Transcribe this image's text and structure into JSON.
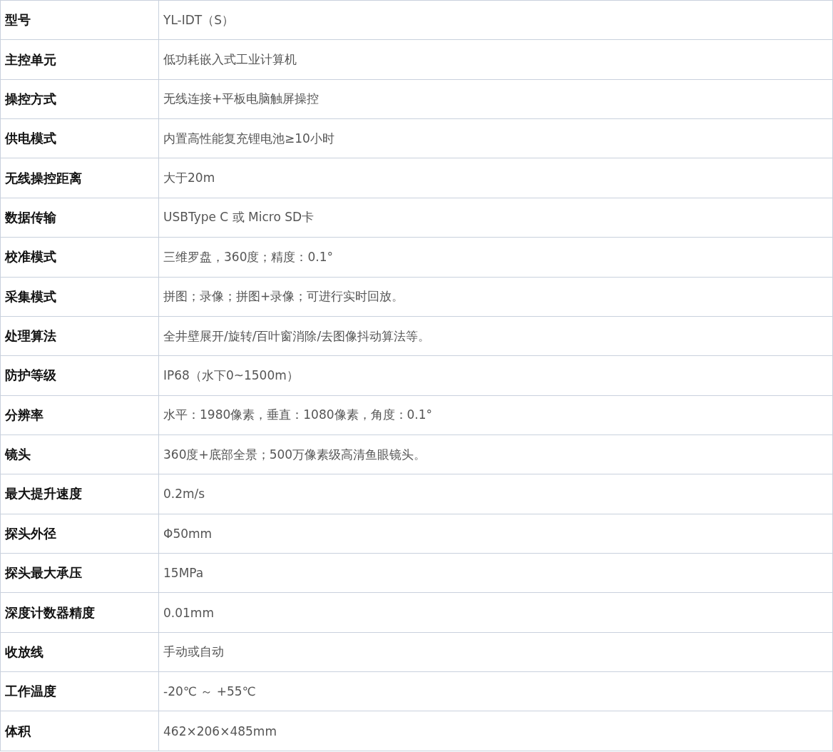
{
  "table": {
    "rows": [
      {
        "label": "型号",
        "value": "YL-IDT（S）"
      },
      {
        "label": "主控单元",
        "value": "低功耗嵌入式工业计算机"
      },
      {
        "label": "操控方式",
        "value": "无线连接+平板电脑触屏操控"
      },
      {
        "label": "供电模式",
        "value": "内置高性能复充锂电池≥10小时"
      },
      {
        "label": "无线操控距离",
        "value": "大于20m"
      },
      {
        "label": "数据传输",
        "value": "USBType C 或 Micro SD卡"
      },
      {
        "label": "校准模式",
        "value": "三维罗盘，360度；精度：0.1°"
      },
      {
        "label": "采集模式",
        "value": "拼图；录像；拼图+录像；可进行实时回放。"
      },
      {
        "label": "处理算法",
        "value": "全井壁展开/旋转/百叶窗消除/去图像抖动算法等。"
      },
      {
        "label": "防护等级",
        "value": "IP68（水下0~1500m）"
      },
      {
        "label": "分辨率",
        "value": "水平：1980像素，垂直：1080像素，角度：0.1°"
      },
      {
        "label": "镜头",
        "value": "360度+底部全景；500万像素级高清鱼眼镜头。"
      },
      {
        "label": "最大提升速度",
        "value": "0.2m/s"
      },
      {
        "label": "探头外径",
        "value": "Φ50mm"
      },
      {
        "label": "探头最大承压",
        "value": "15MPa"
      },
      {
        "label": "深度计数器精度",
        "value": "0.01mm"
      },
      {
        "label": "收放线",
        "value": "手动或自动"
      },
      {
        "label": "工作温度",
        "value": "-20℃ ～ +55℃"
      },
      {
        "label": "体积",
        "value": "462×206×485mm"
      }
    ]
  }
}
